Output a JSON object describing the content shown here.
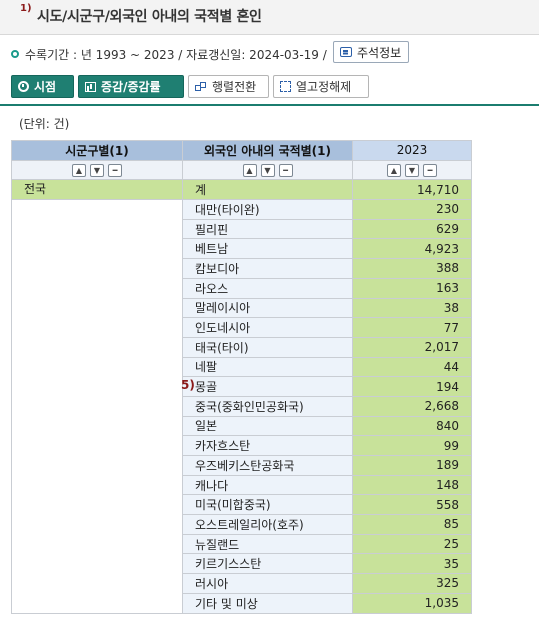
{
  "header": {
    "footnote_mark": "1)",
    "title": "시도/시군구/외국인 아내의 국적별 혼인"
  },
  "info": {
    "text": "수록기간 : 년 1993 ~ 2023 / 자료갱신일: 2024-03-19 /",
    "note_button": "주석정보"
  },
  "toolbar": {
    "time_label": "시점",
    "change_label": "증감/증감률",
    "pivot_label": "행렬전환",
    "merge_label": "열고정해제"
  },
  "unit_label": "(단위: 건)",
  "table": {
    "col_region": "시군구별(1)",
    "col_nationality": "외국인 아내의 국적별(1)",
    "col_year": "2023",
    "region": "전국",
    "rows": [
      {
        "cat": "계",
        "val": "14,710"
      },
      {
        "cat": "대만(타이완)",
        "val": "230"
      },
      {
        "cat": "필리핀",
        "val": "629"
      },
      {
        "cat": "베트남",
        "val": "4,923"
      },
      {
        "cat": "캄보디아",
        "val": "388"
      },
      {
        "cat": "라오스",
        "val": "163"
      },
      {
        "cat": "말레이시아",
        "val": "38"
      },
      {
        "cat": "인도네시아",
        "val": "77"
      },
      {
        "cat": "태국(타이)",
        "val": "2,017"
      },
      {
        "cat": "네팔",
        "val": "44"
      },
      {
        "cat": "몽골",
        "val": "194",
        "note": "5)"
      },
      {
        "cat": "중국(중화인민공화국)",
        "val": "2,668"
      },
      {
        "cat": "일본",
        "val": "840"
      },
      {
        "cat": "카자흐스탄",
        "val": "99"
      },
      {
        "cat": "우즈베키스탄공화국",
        "val": "189"
      },
      {
        "cat": "캐나다",
        "val": "148"
      },
      {
        "cat": "미국(미합중국)",
        "val": "558"
      },
      {
        "cat": "오스트레일리아(호주)",
        "val": "85"
      },
      {
        "cat": "뉴질랜드",
        "val": "25"
      },
      {
        "cat": "키르기스스탄",
        "val": "35"
      },
      {
        "cat": "러시아",
        "val": "325"
      },
      {
        "cat": "기타 및 미상",
        "val": "1,035"
      }
    ]
  },
  "icons": {
    "up": "chevron-up",
    "down": "chevron-down",
    "minus": "minus"
  }
}
